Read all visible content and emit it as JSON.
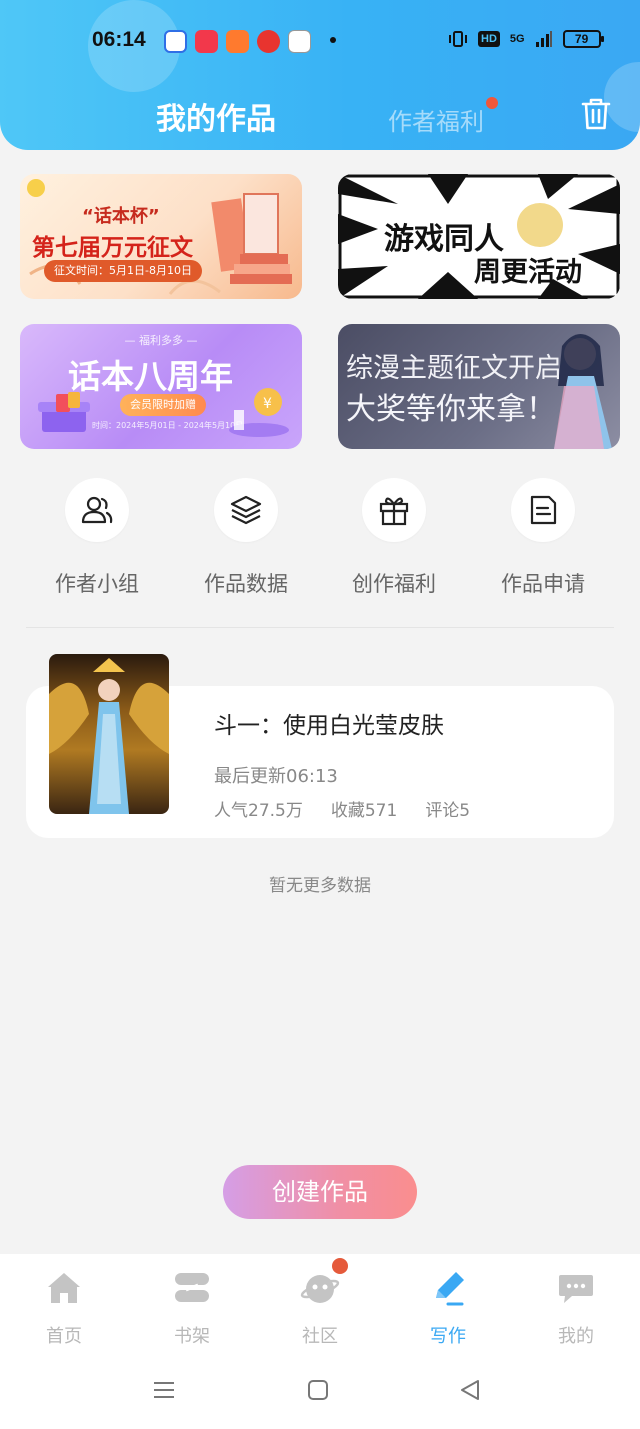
{
  "status_bar": {
    "time": "06:14",
    "network": "5G",
    "hd": "HD",
    "battery": "79"
  },
  "header": {
    "tab_my_works": "我的作品",
    "tab_author_benefits": "作者福利",
    "trash_icon": "trash-icon"
  },
  "banners": [
    {
      "line1": "“话本杯”",
      "line2": "第七届万元征文",
      "date": "征文时间：5月1日-8月10日"
    },
    {
      "line1": "游戏同人",
      "line2": "周更活动"
    },
    {
      "tag": "— 福利多多 —",
      "title": "话本八周年",
      "pill": "会员限时加赠",
      "foot": "时间：2024年5月01日 - 2024年5月10日"
    },
    {
      "line1": "综漫主题征文开启",
      "line2": "大奖等你来拿！"
    }
  ],
  "quick_actions": [
    {
      "label": "作者小组",
      "icon": "users-icon"
    },
    {
      "label": "作品数据",
      "icon": "layers-icon"
    },
    {
      "label": "创作福利",
      "icon": "gift-icon"
    },
    {
      "label": "作品申请",
      "icon": "document-icon"
    }
  ],
  "work": {
    "title": "斗一：使用白光莹皮肤",
    "last_update": "最后更新06:13",
    "popularity": "人气27.5万",
    "favorites": "收藏571",
    "comments": "评论5"
  },
  "no_more": "暂无更多数据",
  "create_button": "创建作品",
  "bottom_nav": [
    {
      "label": "首页",
      "icon": "home-icon"
    },
    {
      "label": "书架",
      "icon": "bookshelf-icon"
    },
    {
      "label": "社区",
      "icon": "planet-icon"
    },
    {
      "label": "写作",
      "icon": "pen-icon",
      "active": true
    },
    {
      "label": "我的",
      "icon": "chat-bubble-icon"
    }
  ],
  "colors": {
    "header_gradient_start": "#4fc7f7",
    "header_gradient_end": "#3aa8f3",
    "active_nav": "#3aa8f3",
    "badge_red": "#e55a3b",
    "create_gradient_start": "#d59ee6",
    "create_gradient_end": "#fa8e8e"
  }
}
